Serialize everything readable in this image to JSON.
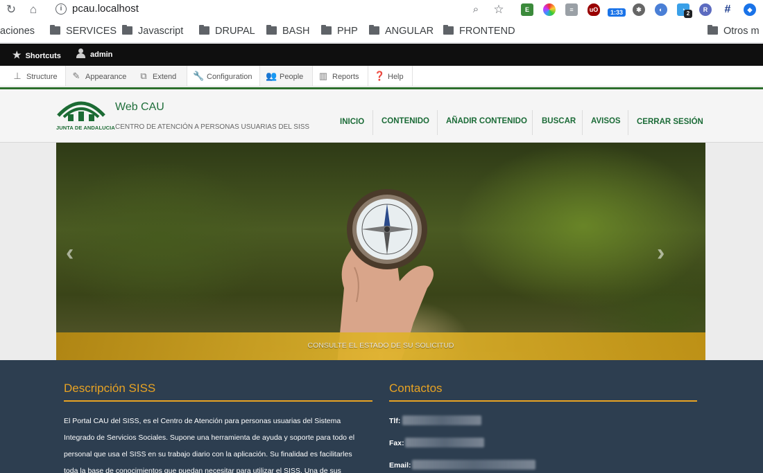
{
  "browser": {
    "url": "pcau.localhost",
    "badge_count": "1:33",
    "notif_count": "2",
    "bookmarks": [
      "taciones",
      "SERVICES",
      "Javascript",
      "DRUPAL",
      "BASH",
      "PHP",
      "ANGULAR",
      "FRONTEND",
      "Otros m"
    ]
  },
  "toolbar": {
    "shortcuts": "Shortcuts",
    "user": "admin",
    "tray": [
      "Structure",
      "Appearance",
      "Extend",
      "Configuration",
      "People",
      "Reports",
      "Help"
    ]
  },
  "site": {
    "logo_text": "JUNTA DE ANDALUCIA",
    "name": "Web CAU",
    "slogan": "CENTRO DE ATENCIÓN A PERSONAS USUARIAS DEL SISS",
    "nav": [
      "INICIO",
      "CONTENIDO",
      "AÑADIR CONTENIDO",
      "BUSCAR",
      "AVISOS",
      "CERRAR SESIÓN"
    ]
  },
  "hero": {
    "caption": "CONSULTE EL ESTADO DE SU SOLICITUD",
    "prev": "‹",
    "next": "›"
  },
  "description": {
    "title": "Descripción SISS",
    "lines": [
      "El Portal CAU del SISS, es el Centro de Atención para personas usuarias del Sistema",
      "Integrado de Servicios Sociales. Supone una herramienta de ayuda y soporte para todo el",
      "personal que usa el SISS en su trabajo diario con la aplicación. Su finalidad es facilitarles",
      "toda la base de conocimientos que puedan necesitar para utilizar el SISS. Una de sus"
    ]
  },
  "contacts": {
    "title": "Contactos",
    "phone_label": "Tlf:",
    "fax_label": "Fax:",
    "email_label": "Email:"
  },
  "colors": {
    "accent": "#e8a323",
    "brand_green": "#1b6b37",
    "footer_bg": "#2d3e50"
  }
}
